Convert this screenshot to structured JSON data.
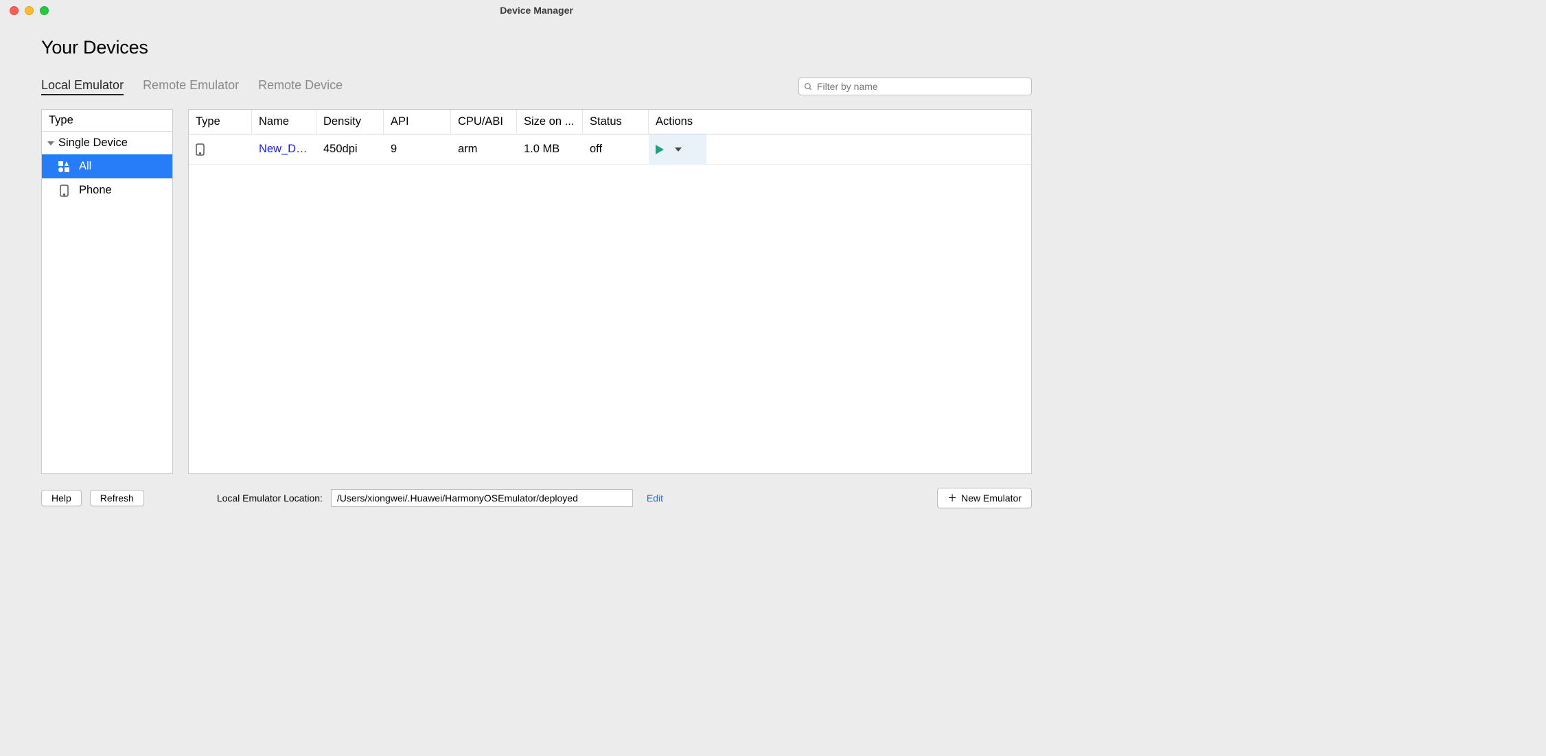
{
  "window": {
    "title": "Device Manager"
  },
  "page": {
    "title": "Your Devices"
  },
  "tabs": {
    "items": [
      {
        "label": "Local Emulator",
        "active": true
      },
      {
        "label": "Remote Emulator",
        "active": false
      },
      {
        "label": "Remote Device",
        "active": false
      }
    ]
  },
  "search": {
    "placeholder": "Filter by name",
    "value": ""
  },
  "sidebar": {
    "header": "Type",
    "group_label": "Single Device",
    "items": [
      {
        "label": "All",
        "selected": true,
        "icon": "grid-all-icon"
      },
      {
        "label": "Phone",
        "selected": false,
        "icon": "device-phone-icon"
      }
    ]
  },
  "table": {
    "columns": [
      "Type",
      "Name",
      "Density",
      "API",
      "CPU/ABI",
      "Size on ...",
      "Status",
      "Actions"
    ],
    "rows": [
      {
        "type_icon": "device-phone-icon",
        "name": "New_De...",
        "density": "450dpi",
        "api": "9",
        "cpu_abi": "arm",
        "size_on_disk": "1.0 MB",
        "status": "off"
      }
    ]
  },
  "footer": {
    "help_label": "Help",
    "refresh_label": "Refresh",
    "location_label": "Local Emulator Location:",
    "location_value": "/Users/xiongwei/.Huawei/HarmonyOSEmulator/deployed",
    "edit_label": "Edit",
    "new_emulator_label": "New Emulator"
  }
}
